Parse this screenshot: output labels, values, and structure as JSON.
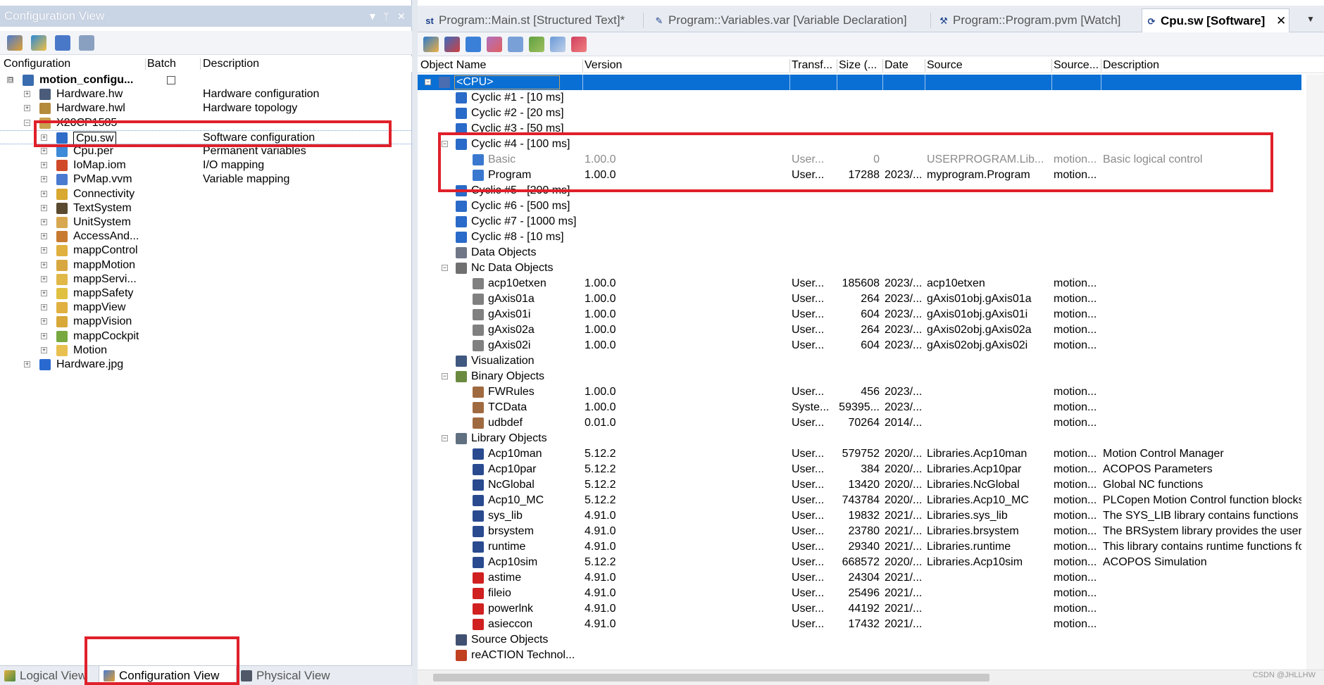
{
  "left_pane": {
    "title": "Configuration View",
    "ctrl_dropdown": "▼",
    "ctrl_pin": "ᛘ",
    "ctrl_close": "✕",
    "headers": {
      "configuration": "Configuration",
      "batch": "Batch",
      "description": "Description"
    },
    "tree": [
      {
        "name": "motion_configu...",
        "desc": "",
        "level": 0,
        "expander": "⊟",
        "bold": true,
        "checkbox": true,
        "icon_color": "#3a6cb0"
      },
      {
        "name": "Hardware.hw",
        "desc": "Hardware configuration",
        "level": 1,
        "expander": "+",
        "icon_color": "#4a5c7a"
      },
      {
        "name": "Hardware.hwl",
        "desc": "Hardware topology",
        "level": 1,
        "expander": "+",
        "icon_color": "#b48a3c"
      },
      {
        "name": "X20CP1585",
        "desc": "",
        "level": 1,
        "expander": "−",
        "icon_color": "#c8a050"
      },
      {
        "name": "Cpu.sw",
        "desc": "Software configuration",
        "level": 2,
        "expander": "+",
        "icon_color": "#2f6dc8",
        "selected": true
      },
      {
        "name": "Cpu.per",
        "desc": "Permanent variables",
        "level": 2,
        "expander": "+",
        "icon_color": "#3c8ad8"
      },
      {
        "name": "IoMap.iom",
        "desc": "I/O mapping",
        "level": 2,
        "expander": "+",
        "icon_color": "#d04a2a"
      },
      {
        "name": "PvMap.vvm",
        "desc": "Variable mapping",
        "level": 2,
        "expander": "+",
        "icon_color": "#4a7ad0"
      },
      {
        "name": "Connectivity",
        "desc": "",
        "level": 2,
        "expander": "+",
        "icon_color": "#d8a830"
      },
      {
        "name": "TextSystem",
        "desc": "",
        "level": 2,
        "expander": "+",
        "icon_color": "#5a4a30"
      },
      {
        "name": "UnitSystem",
        "desc": "",
        "level": 2,
        "expander": "+",
        "icon_color": "#d8a850"
      },
      {
        "name": "AccessAnd...",
        "desc": "",
        "level": 2,
        "expander": "+",
        "icon_color": "#c87a30"
      },
      {
        "name": "mappControl",
        "desc": "",
        "level": 2,
        "expander": "+",
        "icon_color": "#e0b040"
      },
      {
        "name": "mappMotion",
        "desc": "",
        "level": 2,
        "expander": "+",
        "icon_color": "#d8a840"
      },
      {
        "name": "mappServi...",
        "desc": "",
        "level": 2,
        "expander": "+",
        "icon_color": "#e0b848"
      },
      {
        "name": "mappSafety",
        "desc": "",
        "level": 2,
        "expander": "+",
        "icon_color": "#e0c040"
      },
      {
        "name": "mappView",
        "desc": "",
        "level": 2,
        "expander": "+",
        "icon_color": "#e0b040"
      },
      {
        "name": "mappVision",
        "desc": "",
        "level": 2,
        "expander": "+",
        "icon_color": "#d8a838"
      },
      {
        "name": "mappCockpit",
        "desc": "",
        "level": 2,
        "expander": "+",
        "icon_color": "#78a840"
      },
      {
        "name": "Motion",
        "desc": "",
        "level": 2,
        "expander": "+",
        "icon_color": "#e8c050"
      },
      {
        "name": "Hardware.jpg",
        "desc": "",
        "level": 1,
        "expander": "+",
        "icon_color": "#2a6ad0"
      }
    ],
    "bottom_tabs": [
      {
        "label": "Logical View",
        "active": false
      },
      {
        "label": "Configuration View",
        "active": true
      },
      {
        "label": "Physical View",
        "active": false
      }
    ]
  },
  "right_pane": {
    "doc_tabs": [
      {
        "label": "Program::Main.st [Structured Text]*",
        "icon": "st",
        "active": false
      },
      {
        "label": "Program::Variables.var [Variable Declaration]",
        "icon": "✎",
        "active": false
      },
      {
        "label": "Program::Program.pvm [Watch]",
        "icon": "⚒",
        "active": false
      },
      {
        "label": "Cpu.sw [Software]",
        "icon": "⟳",
        "active": true
      }
    ],
    "tab_close": "✕",
    "tab_menu": "▼",
    "headers": {
      "object_name": "Object Name",
      "version": "Version",
      "transfer": "Transf...",
      "size": "Size (...",
      "date": "Date",
      "source": "Source",
      "source_dots": "Source...",
      "description": "Description"
    },
    "rows": [
      {
        "name": "<CPU>",
        "level": 0,
        "expander": "−",
        "selected": true,
        "icon": "#4a6cb0"
      },
      {
        "name": "Cyclic #1 - [10 ms]",
        "level": 1,
        "icon": "#2a6ac8"
      },
      {
        "name": "Cyclic #2 - [20 ms]",
        "level": 1,
        "icon": "#2a6ac8"
      },
      {
        "name": "Cyclic #3 - [50 ms]",
        "level": 1,
        "icon": "#2a6ac8"
      },
      {
        "name": "Cyclic #4 - [100 ms]",
        "level": 1,
        "expander": "−",
        "icon": "#2a6ac8"
      },
      {
        "name": "Basic",
        "level": 2,
        "version": "1.00.0",
        "transfer": "User...",
        "size": "0",
        "date": "",
        "source": "USERPROGRAM.Lib...",
        "source2": "motion...",
        "desc": "Basic logical control",
        "grey": true,
        "icon": "#3a78d0"
      },
      {
        "name": "Program",
        "level": 2,
        "version": "1.00.0",
        "transfer": "User...",
        "size": "17288",
        "date": "2023/...",
        "source": "myprogram.Program",
        "source2": "motion...",
        "desc": "",
        "icon": "#3a78d0"
      },
      {
        "name": "Cyclic #5 - [200 ms]",
        "level": 1,
        "icon": "#2a6ac8"
      },
      {
        "name": "Cyclic #6 - [500 ms]",
        "level": 1,
        "icon": "#2a6ac8"
      },
      {
        "name": "Cyclic #7 - [1000 ms]",
        "level": 1,
        "icon": "#2a6ac8"
      },
      {
        "name": "Cyclic #8 - [10 ms]",
        "level": 1,
        "icon": "#2a6ac8"
      },
      {
        "name": "Data Objects",
        "level": 1,
        "icon": "#707888"
      },
      {
        "name": "Nc Data Objects",
        "level": 1,
        "expander": "−",
        "icon": "#707070"
      },
      {
        "name": "acp10etxen",
        "level": 2,
        "version": "1.00.0",
        "transfer": "User...",
        "size": "185608",
        "date": "2023/...",
        "source": "acp10etxen",
        "source2": "motion...",
        "desc": "",
        "icon": "#808080"
      },
      {
        "name": "gAxis01a",
        "level": 2,
        "version": "1.00.0",
        "transfer": "User...",
        "size": "264",
        "date": "2023/...",
        "source": "gAxis01obj.gAxis01a",
        "source2": "motion...",
        "desc": "",
        "icon": "#808080"
      },
      {
        "name": "gAxis01i",
        "level": 2,
        "version": "1.00.0",
        "transfer": "User...",
        "size": "604",
        "date": "2023/...",
        "source": "gAxis01obj.gAxis01i",
        "source2": "motion...",
        "desc": "",
        "icon": "#808080"
      },
      {
        "name": "gAxis02a",
        "level": 2,
        "version": "1.00.0",
        "transfer": "User...",
        "size": "264",
        "date": "2023/...",
        "source": "gAxis02obj.gAxis02a",
        "source2": "motion...",
        "desc": "",
        "icon": "#808080"
      },
      {
        "name": "gAxis02i",
        "level": 2,
        "version": "1.00.0",
        "transfer": "User...",
        "size": "604",
        "date": "2023/...",
        "source": "gAxis02obj.gAxis02i",
        "source2": "motion...",
        "desc": "",
        "icon": "#808080"
      },
      {
        "name": "Visualization",
        "level": 1,
        "icon": "#405880"
      },
      {
        "name": "Binary Objects",
        "level": 1,
        "expander": "−",
        "icon": "#6a8a40"
      },
      {
        "name": "FWRules",
        "level": 2,
        "version": "1.00.0",
        "transfer": "User...",
        "size": "456",
        "date": "2023/...",
        "source": "",
        "source2": "motion...",
        "desc": "",
        "icon": "#a06a40"
      },
      {
        "name": "TCData",
        "level": 2,
        "version": "1.00.0",
        "transfer": "Syste...",
        "size": "59395...",
        "date": "2023/...",
        "source": "",
        "source2": "motion...",
        "desc": "",
        "icon": "#a06a40"
      },
      {
        "name": "udbdef",
        "level": 2,
        "version": "0.01.0",
        "transfer": "User...",
        "size": "70264",
        "date": "2014/...",
        "source": "",
        "source2": "motion...",
        "desc": "",
        "icon": "#a06a40"
      },
      {
        "name": "Library Objects",
        "level": 1,
        "expander": "−",
        "icon": "#607080"
      },
      {
        "name": "Acp10man",
        "level": 2,
        "version": "5.12.2",
        "transfer": "User...",
        "size": "579752",
        "date": "2020/...",
        "source": "Libraries.Acp10man",
        "source2": "motion...",
        "desc": "Motion Control Manager",
        "icon": "#2a4a90"
      },
      {
        "name": "Acp10par",
        "level": 2,
        "version": "5.12.2",
        "transfer": "User...",
        "size": "384",
        "date": "2020/...",
        "source": "Libraries.Acp10par",
        "source2": "motion...",
        "desc": "ACOPOS Parameters",
        "icon": "#2a4a90"
      },
      {
        "name": "NcGlobal",
        "level": 2,
        "version": "5.12.2",
        "transfer": "User...",
        "size": "13420",
        "date": "2020/...",
        "source": "Libraries.NcGlobal",
        "source2": "motion...",
        "desc": "Global NC functions",
        "icon": "#2a4a90"
      },
      {
        "name": "Acp10_MC",
        "level": 2,
        "version": "5.12.2",
        "transfer": "User...",
        "size": "743784",
        "date": "2020/...",
        "source": "Libraries.Acp10_MC",
        "source2": "motion...",
        "desc": "PLCopen Motion Control function blocks",
        "icon": "#2a4a90"
      },
      {
        "name": "sys_lib",
        "level": 2,
        "version": "4.91.0",
        "transfer": "User...",
        "size": "19832",
        "date": "2021/...",
        "source": "Libraries.sys_lib",
        "source2": "motion...",
        "desc": "The SYS_LIB library contains functions fo",
        "icon": "#2a4a90"
      },
      {
        "name": "brsystem",
        "level": 2,
        "version": "4.91.0",
        "transfer": "User...",
        "size": "23780",
        "date": "2021/...",
        "source": "Libraries.brsystem",
        "source2": "motion...",
        "desc": "The BRSystem library provides the user w",
        "icon": "#2a4a90"
      },
      {
        "name": "runtime",
        "level": 2,
        "version": "4.91.0",
        "transfer": "User...",
        "size": "29340",
        "date": "2021/...",
        "source": "Libraries.runtime",
        "source2": "motion...",
        "desc": "This library contains runtime functions for",
        "icon": "#2a4a90"
      },
      {
        "name": "Acp10sim",
        "level": 2,
        "version": "5.12.2",
        "transfer": "User...",
        "size": "668572",
        "date": "2020/...",
        "source": "Libraries.Acp10sim",
        "source2": "motion...",
        "desc": "ACOPOS Simulation",
        "icon": "#2a4a90"
      },
      {
        "name": "astime",
        "level": 2,
        "version": "4.91.0",
        "transfer": "User...",
        "size": "24304",
        "date": "2021/...",
        "source": "",
        "source2": "motion...",
        "desc": "",
        "icon": "#d02020"
      },
      {
        "name": "fileio",
        "level": 2,
        "version": "4.91.0",
        "transfer": "User...",
        "size": "25496",
        "date": "2021/...",
        "source": "",
        "source2": "motion...",
        "desc": "",
        "icon": "#d02020"
      },
      {
        "name": "powerlnk",
        "level": 2,
        "version": "4.91.0",
        "transfer": "User...",
        "size": "44192",
        "date": "2021/...",
        "source": "",
        "source2": "motion...",
        "desc": "",
        "icon": "#d02020"
      },
      {
        "name": "asieccon",
        "level": 2,
        "version": "4.91.0",
        "transfer": "User...",
        "size": "17432",
        "date": "2021/...",
        "source": "",
        "source2": "motion...",
        "desc": "",
        "icon": "#d02020"
      },
      {
        "name": "Source Objects",
        "level": 1,
        "icon": "#405070"
      },
      {
        "name": "reACTION Technol...",
        "level": 1,
        "icon": "#c04020"
      }
    ]
  },
  "watermark": "CSDN @JHLLHW",
  "colors": {
    "selection": "#0a6fd4",
    "highlight": "#e0202a"
  }
}
